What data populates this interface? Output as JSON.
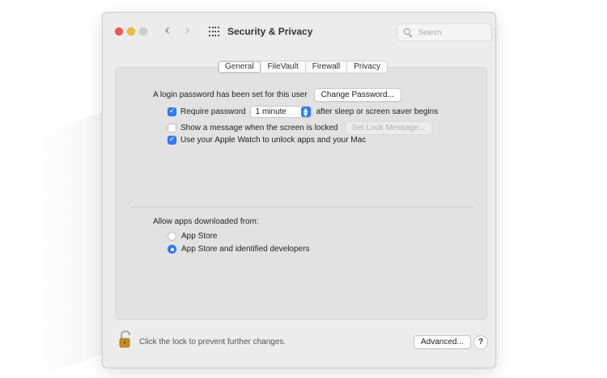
{
  "window": {
    "title": "Security & Privacy",
    "search_placeholder": "Search"
  },
  "icons": {
    "back": "chevron-left",
    "forward": "chevron-right",
    "show_all": "grid",
    "search": "magnifier",
    "lock": "padlock-open"
  },
  "tabs": [
    {
      "label": "General",
      "selected": true
    },
    {
      "label": "FileVault",
      "selected": false
    },
    {
      "label": "Firewall",
      "selected": false
    },
    {
      "label": "Privacy",
      "selected": false
    }
  ],
  "general": {
    "login_password_text": "A login password has been set for this user",
    "change_password_button": "Change Password...",
    "require_password": {
      "label": "Require password",
      "checked": true
    },
    "require_password_delay": "1 minute",
    "require_password_suffix": "after sleep or screen saver begins",
    "show_message": {
      "label": "Show a message when the screen is locked",
      "checked": false
    },
    "set_lock_message_button": "Set Lock Message...",
    "apple_watch": {
      "label": "Use your Apple Watch to unlock apps and your Mac",
      "checked": true
    },
    "allow_apps_heading": "Allow apps downloaded from:",
    "allow_options": [
      {
        "label": "App Store",
        "selected": false
      },
      {
        "label": "App Store and identified developers",
        "selected": true
      }
    ]
  },
  "footer": {
    "lock_text": "Click the lock to prevent further changes.",
    "advanced_button": "Advanced...",
    "help_button": "?"
  },
  "colors": {
    "accent": "#2f7df6",
    "close": "#ee5b55",
    "minimize": "#f5bd3c",
    "zoom_disabled": "#cfcfcf",
    "lock_body": "#c98a2a"
  }
}
